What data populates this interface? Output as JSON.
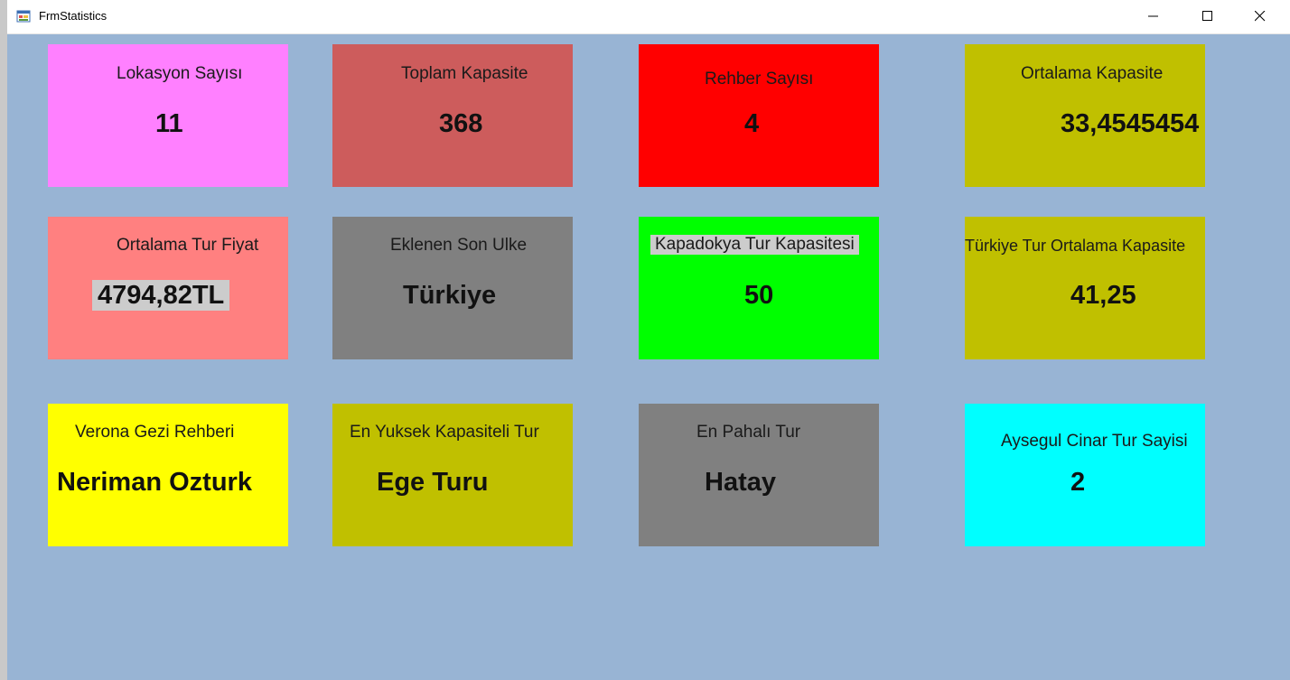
{
  "window": {
    "title": "FrmStatistics"
  },
  "cards": [
    {
      "label": "Lokasyon Sayısı",
      "value": "11",
      "color": "#ff80ff"
    },
    {
      "label": "Toplam Kapasite",
      "value": "368",
      "color": "#cd5c5c"
    },
    {
      "label": "Rehber Sayısı",
      "value": "4",
      "color": "#ff0000"
    },
    {
      "label": "Ortalama Kapasite",
      "value": "33,4545454",
      "color": "#c0c000"
    },
    {
      "label": "Ortalama Tur Fiyat",
      "value": "4794,82TL",
      "color": "#ff8080"
    },
    {
      "label": "Eklenen Son Ulke",
      "value": "Türkiye",
      "color": "#808080"
    },
    {
      "label": "Kapadokya Tur Kapasitesi",
      "value": "50",
      "color": "#00ff00"
    },
    {
      "label": "Türkiye Tur Ortalama Kapasite",
      "value": "41,25",
      "color": "#c0c000"
    },
    {
      "label": "Verona Gezi Rehberi",
      "value": "Neriman Ozturk",
      "color": "#ffff00"
    },
    {
      "label": "En Yuksek Kapasiteli Tur",
      "value": "Ege Turu",
      "color": "#c0c000"
    },
    {
      "label": "En Pahalı Tur",
      "value": "Hatay",
      "color": "#808080"
    },
    {
      "label": "Aysegul Cinar Tur Sayisi",
      "value": "2",
      "color": "#00ffff"
    }
  ],
  "icons": {
    "app": "form-icon",
    "minimize": "minimize-icon",
    "maximize": "maximize-icon",
    "close": "close-icon"
  }
}
